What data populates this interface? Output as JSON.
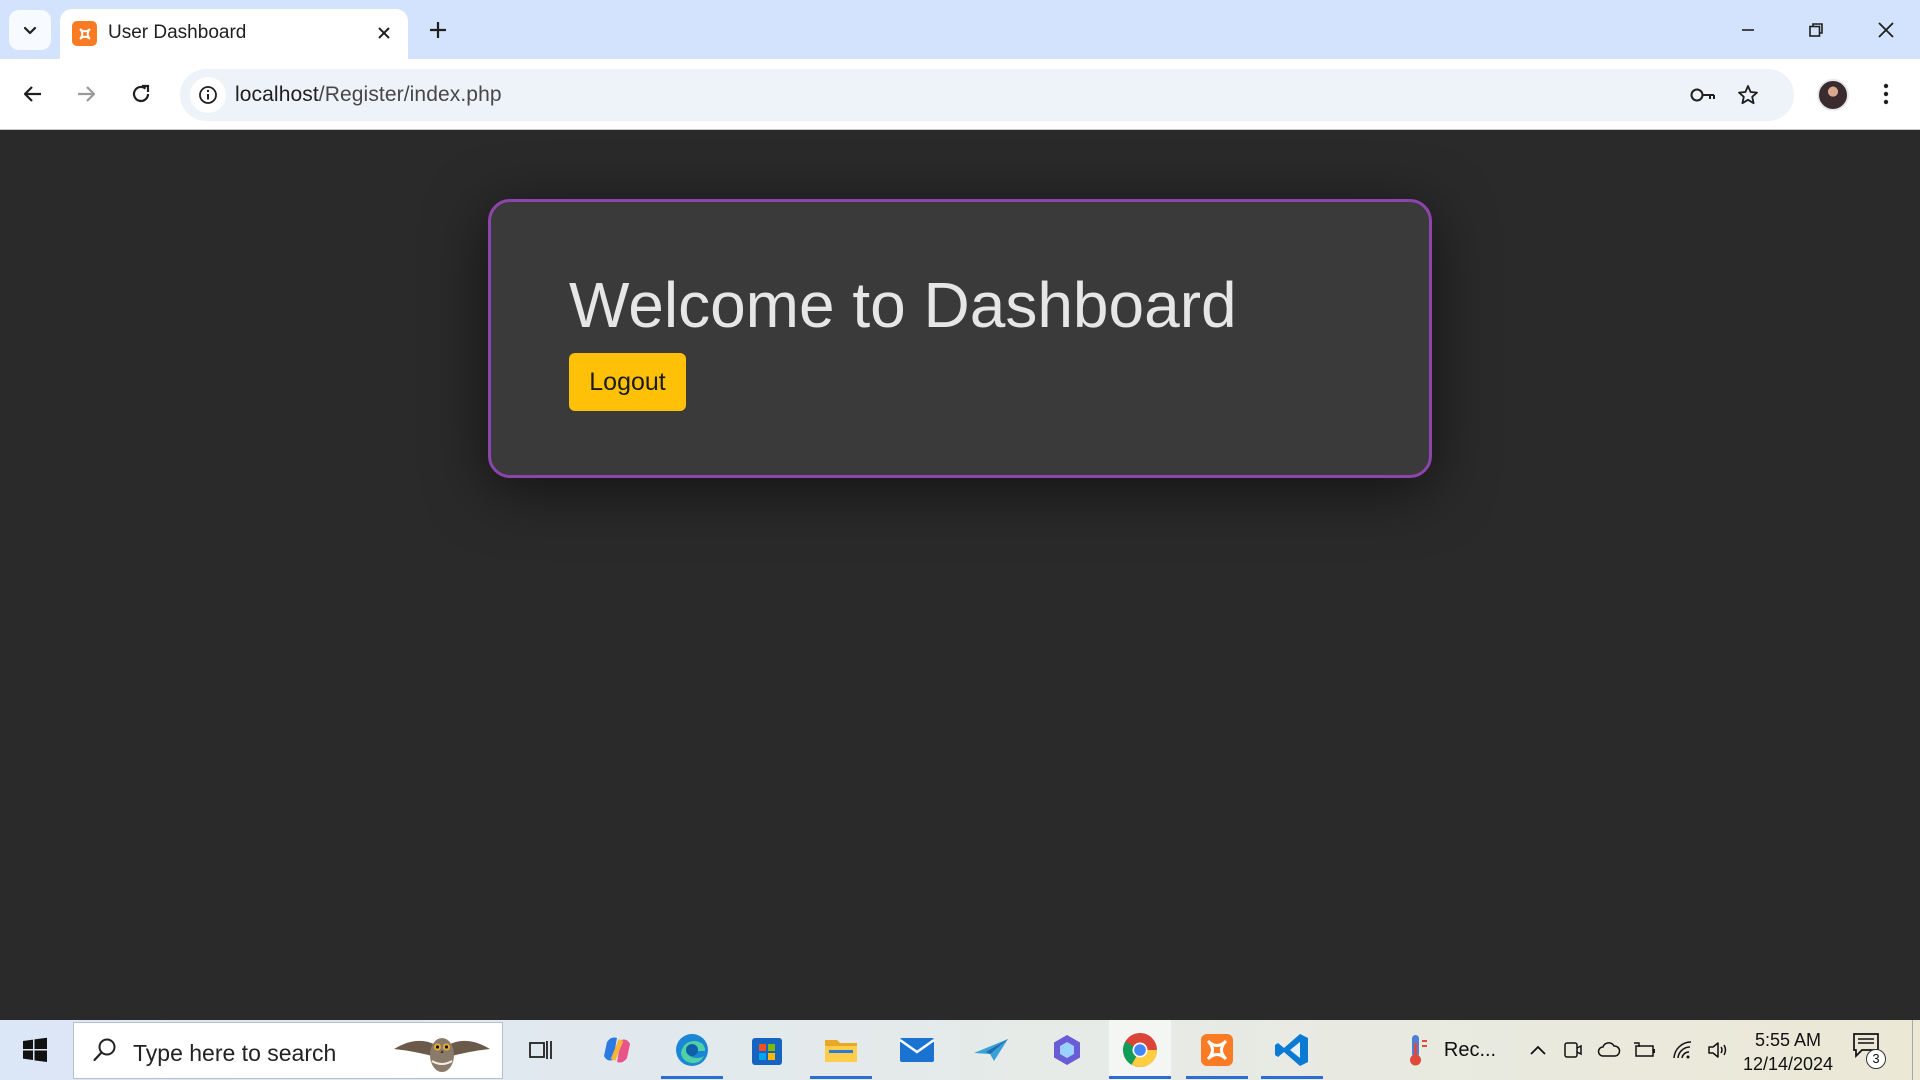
{
  "browser": {
    "tab_title": "User Dashboard",
    "url_host": "localhost",
    "url_path": "/Register/index.php"
  },
  "page": {
    "heading": "Welcome to Dashboard",
    "logout_label": "Logout"
  },
  "taskbar": {
    "search_placeholder": "Type here to search",
    "weather_label": "Rec...",
    "time": "5:55 AM",
    "date": "12/14/2024",
    "notification_count": "3"
  },
  "colors": {
    "page_background": "#2a2a2a",
    "card_background": "#3a3a3a",
    "card_border": "#8e44ad",
    "button": "#ffc107",
    "tabstrip": "#d3e3fd"
  }
}
